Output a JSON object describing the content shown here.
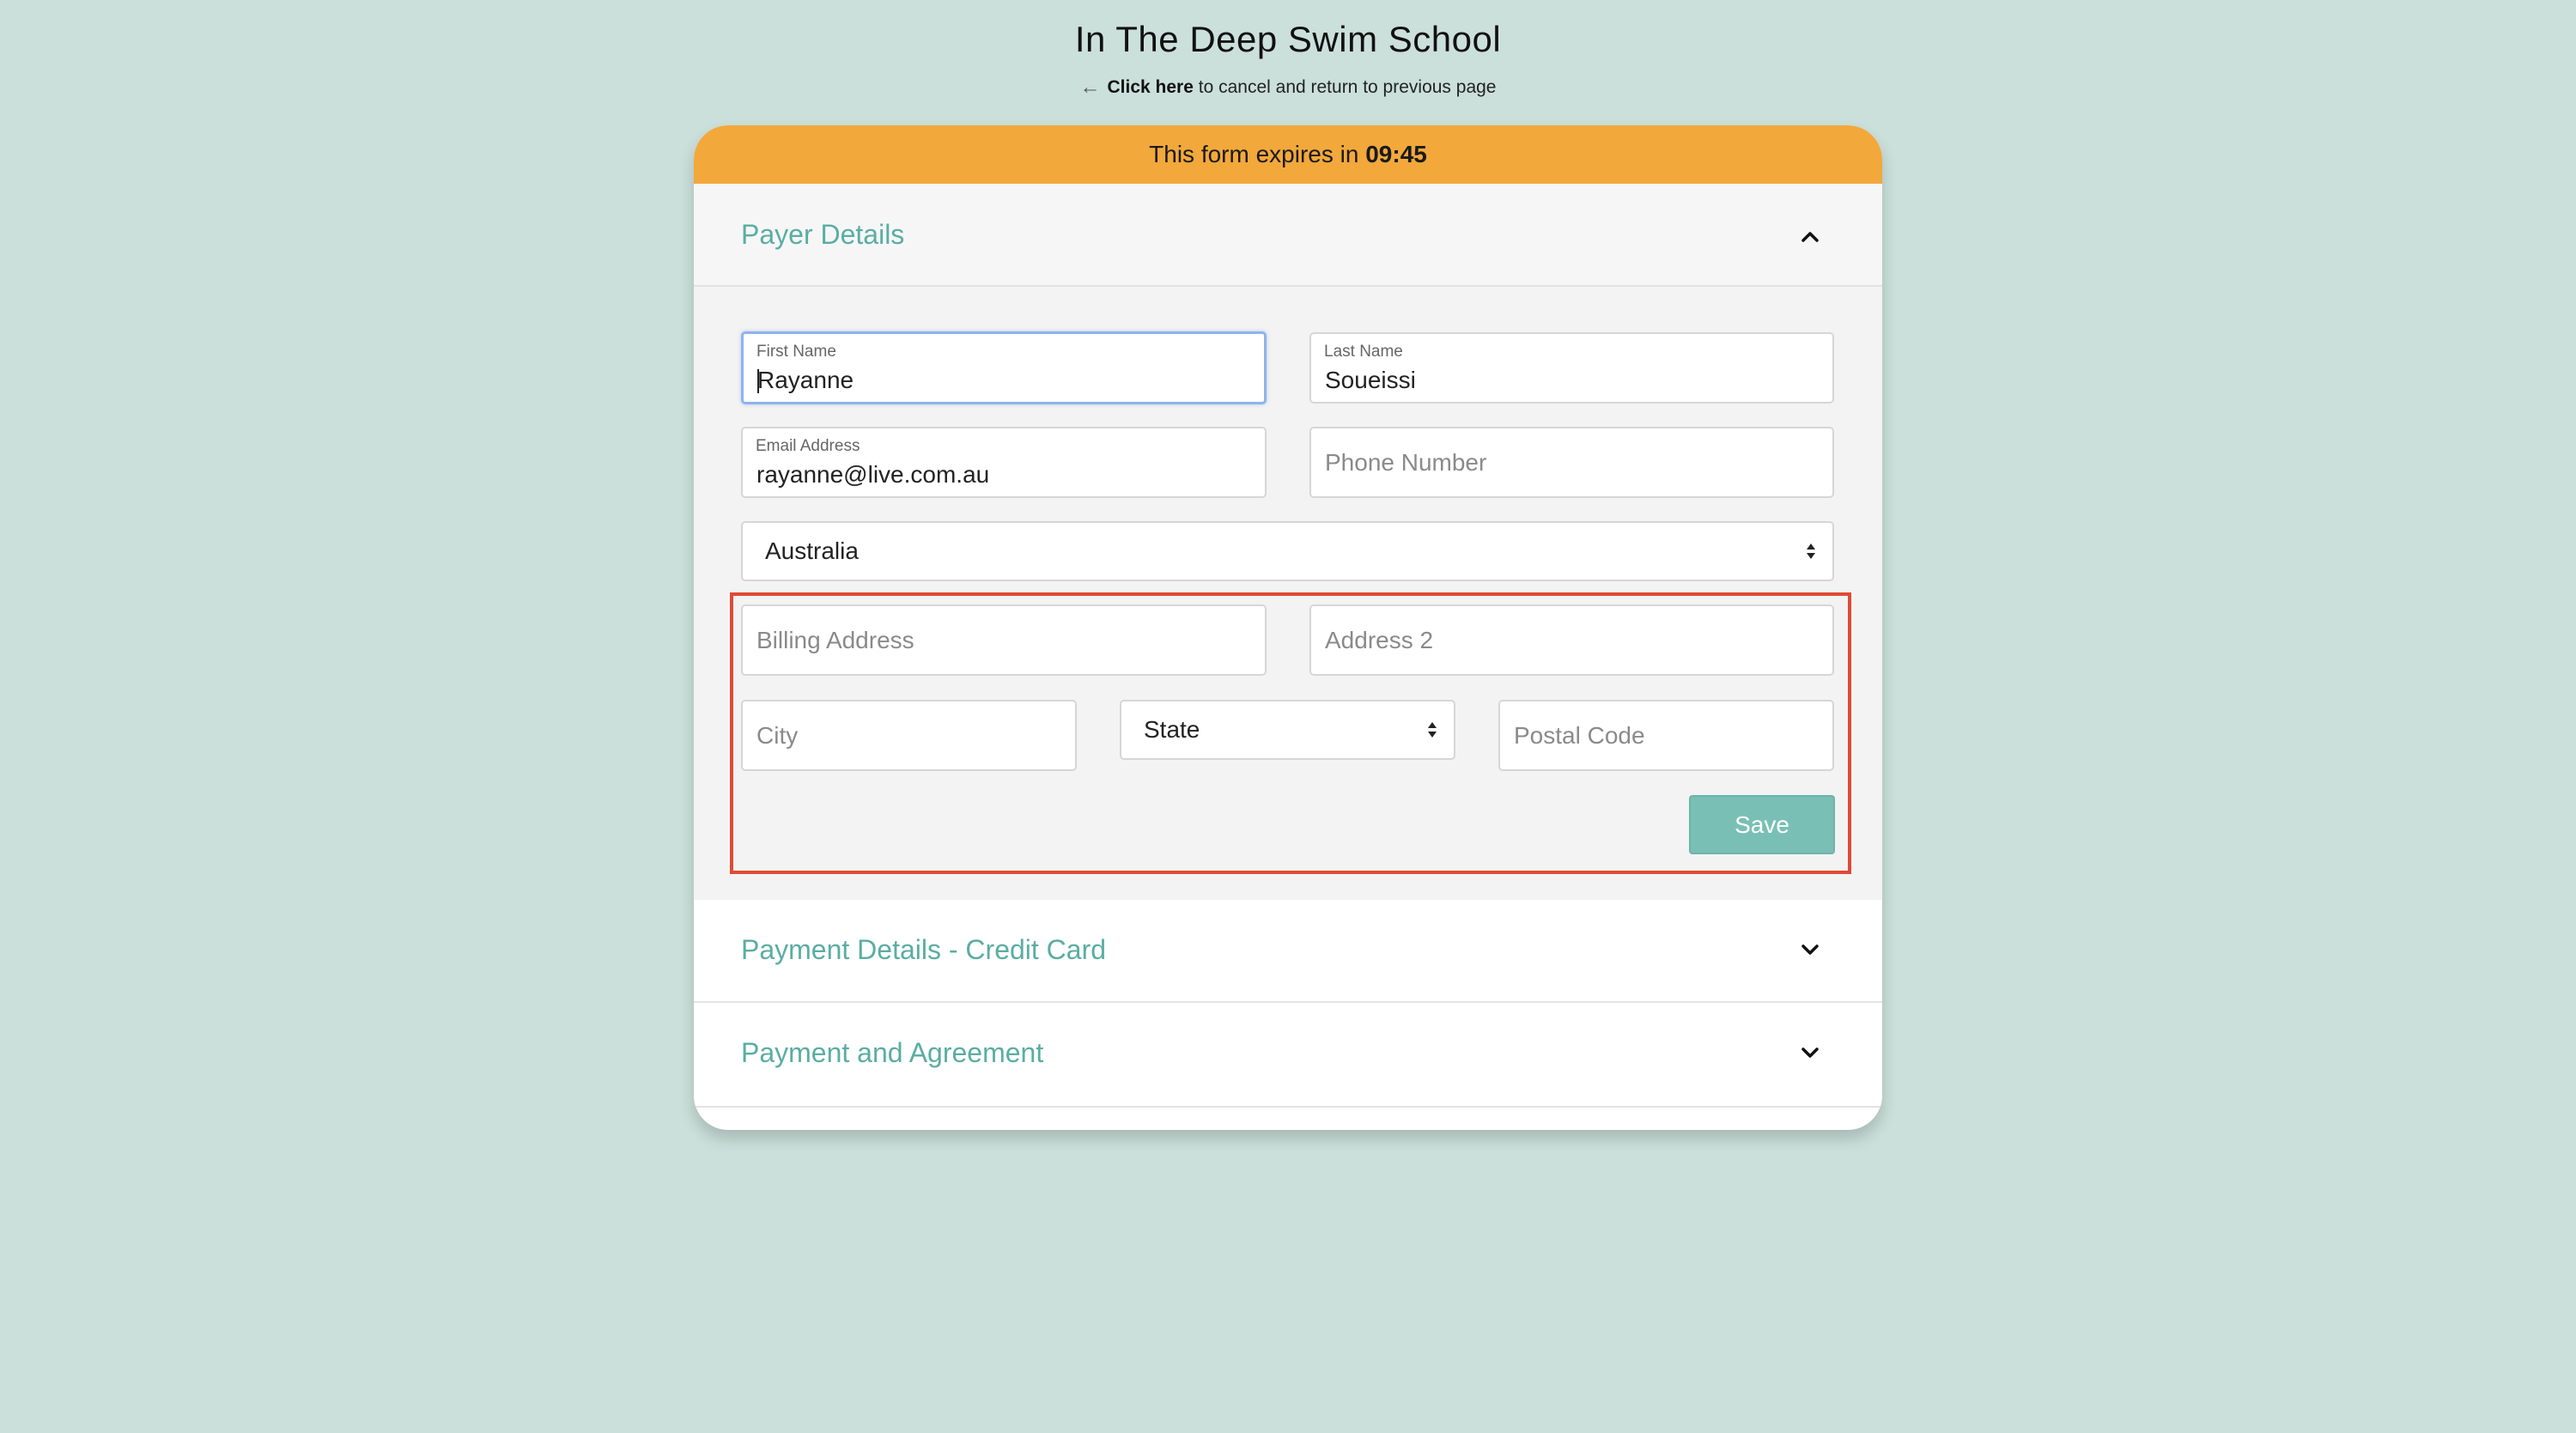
{
  "header": {
    "title": "In The Deep Swim School",
    "cancel_link": "Click here",
    "cancel_suffix": "to cancel and return to previous page"
  },
  "timer": {
    "prefix": "This form expires in",
    "value": "09:45"
  },
  "sections": {
    "payer": {
      "title": "Payer Details",
      "expanded": true
    },
    "payment_cc": {
      "title": "Payment Details - Credit Card",
      "expanded": false
    },
    "agreement": {
      "title": "Payment and Agreement",
      "expanded": false
    }
  },
  "form": {
    "first_name": {
      "label": "First Name",
      "value": "Rayanne"
    },
    "last_name": {
      "label": "Last Name",
      "value": "Soueissi"
    },
    "email": {
      "label": "Email Address",
      "value": "rayanne@live.com.au"
    },
    "phone": {
      "placeholder": "Phone Number"
    },
    "country": {
      "selected": "Australia"
    },
    "billing_address": {
      "placeholder": "Billing Address"
    },
    "address2": {
      "placeholder": "Address 2"
    },
    "city": {
      "placeholder": "City"
    },
    "state": {
      "selected": "State"
    },
    "postal_code": {
      "placeholder": "Postal Code"
    },
    "save_label": "Save"
  },
  "colors": {
    "background": "#cbe0da",
    "timer_bar": "#f2a83b",
    "section_title": "#5aada3",
    "save_button": "#7abfb5",
    "highlight": "#e04a35"
  }
}
